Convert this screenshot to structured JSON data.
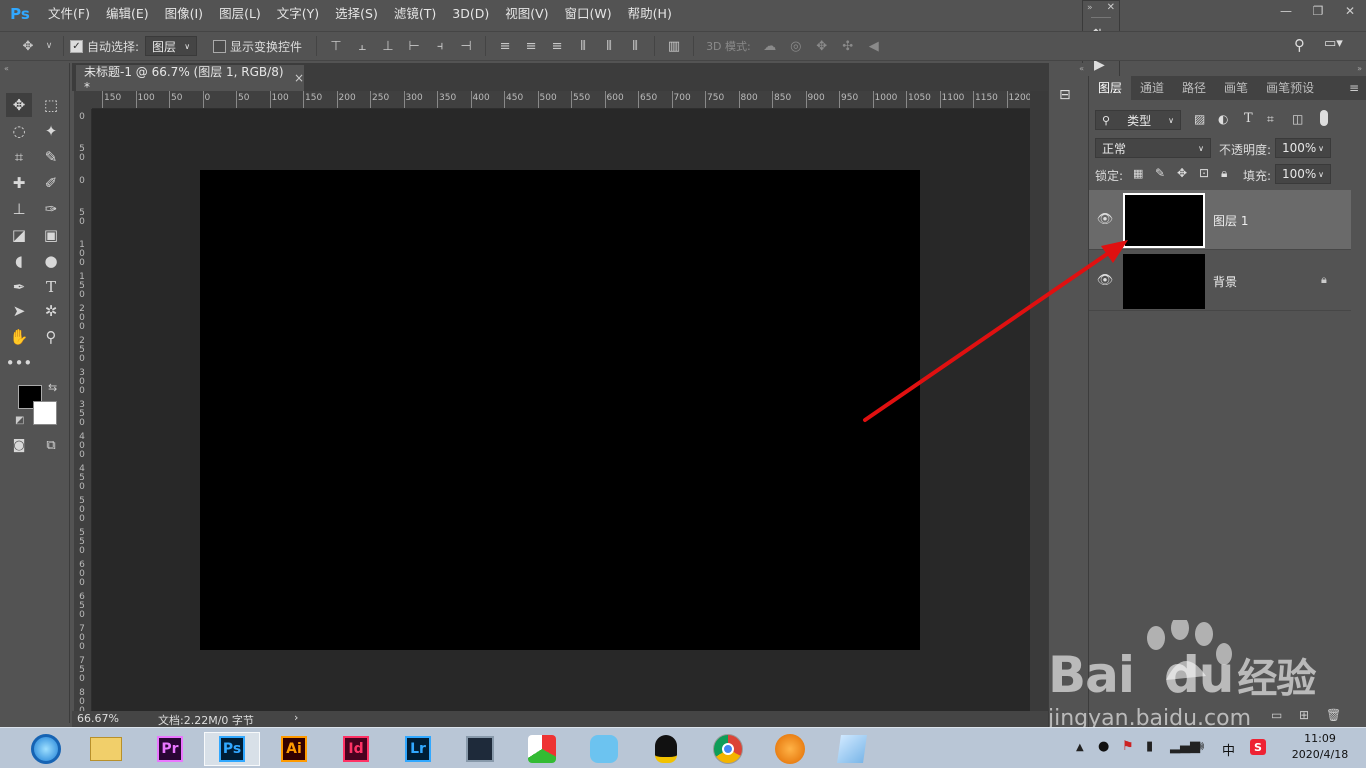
{
  "app": {
    "logo": "Ps",
    "accent": "#31a8ff"
  },
  "menu": [
    "文件(F)",
    "编辑(E)",
    "图像(I)",
    "图层(L)",
    "文字(Y)",
    "选择(S)",
    "滤镜(T)",
    "3D(D)",
    "视图(V)",
    "窗口(W)",
    "帮助(H)"
  ],
  "window_controls": {
    "minimize": "—",
    "restore": "❐",
    "close": "✕"
  },
  "options": {
    "auto_select_label": "自动选择:",
    "auto_select_value": "图层",
    "show_transform_label": "显示变换控件",
    "mode_3d_label": "3D 模式:"
  },
  "document": {
    "tab_title": "未标题-1 @ 66.7% (图层 1, RGB/8) *",
    "close": "×",
    "canvas_color": "#000000"
  },
  "ruler": {
    "top_ticks": [
      "150",
      "100",
      "50",
      "0",
      "50",
      "100",
      "150",
      "200",
      "250",
      "300",
      "350",
      "400",
      "450",
      "500",
      "550",
      "600",
      "650",
      "700",
      "750",
      "800",
      "850",
      "900",
      "950",
      "1000",
      "1050",
      "1100",
      "1150",
      "1200"
    ],
    "left_ticks": [
      "0",
      "5 0",
      "0",
      "5 0",
      "1 0 0",
      "1 5 0",
      "2 0 0",
      "2 5 0",
      "3 0 0",
      "3 5 0",
      "4 0 0",
      "4 5 0",
      "5 0 0",
      "5 5 0",
      "6 0 0",
      "6 5 0",
      "7 0 0",
      "7 5 0",
      "8 0 0",
      "8 5 0"
    ]
  },
  "status": {
    "zoom": "66.67%",
    "doc_info": "文档:2.22M/0 字节",
    "arrow": "›"
  },
  "layers_panel": {
    "tabs": [
      "图层",
      "通道",
      "路径",
      "画笔",
      "画笔预设"
    ],
    "filter_label": "类型",
    "blend_mode": "正常",
    "opacity_label": "不透明度:",
    "opacity_value": "100%",
    "lock_label": "锁定:",
    "fill_label": "填充:",
    "fill_value": "100%",
    "layers": [
      {
        "name": "图层 1",
        "selected": true,
        "locked": false
      },
      {
        "name": "背景",
        "selected": false,
        "locked": true
      }
    ]
  },
  "annotation": {
    "color": "#e01010"
  },
  "taskbar": {
    "apps": [
      {
        "name": "ie",
        "label": ""
      },
      {
        "name": "explorer",
        "label": ""
      },
      {
        "name": "premiere",
        "label": "Pr",
        "color": "#ea77ff",
        "bg": "#2a0634"
      },
      {
        "name": "photoshop",
        "label": "Ps",
        "color": "#31a8ff",
        "bg": "#001e36"
      },
      {
        "name": "illustrator",
        "label": "Ai",
        "color": "#ff9a00",
        "bg": "#330000"
      },
      {
        "name": "indesign",
        "label": "Id",
        "color": "#ff3366",
        "bg": "#49021f"
      },
      {
        "name": "lightroom",
        "label": "Lr",
        "color": "#31a8ff",
        "bg": "#001e36"
      },
      {
        "name": "video",
        "label": ""
      },
      {
        "name": "app-kite",
        "label": ""
      },
      {
        "name": "app-bird",
        "label": ""
      },
      {
        "name": "qq",
        "label": ""
      },
      {
        "name": "chrome",
        "label": ""
      },
      {
        "name": "app-orange",
        "label": ""
      },
      {
        "name": "app-notepad",
        "label": ""
      }
    ],
    "tray_ime": "中",
    "time": "11:09",
    "date": "2020/4/18"
  },
  "watermark": {
    "brand": "Bai",
    "brand2": "du",
    "suffix": "经验",
    "url": "jingyan.baidu.com"
  }
}
